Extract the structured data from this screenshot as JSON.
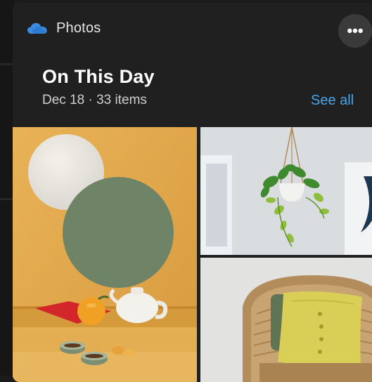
{
  "widget": {
    "app_name": "Photos",
    "app_icon": "onedrive-cloud-icon",
    "more_label": "•••",
    "title": "On This Day",
    "subtitle": "Dec 18 · 33 items",
    "see_all_label": "See all"
  },
  "colors": {
    "card_background": "#202020",
    "accent_link": "#4aa3e8",
    "cloud_icon": "#3c8de0"
  },
  "photos": [
    {
      "subject": "tea-set-still-life"
    },
    {
      "subject": "hanging-plant"
    },
    {
      "subject": "rattan-chair-with-pillow"
    }
  ]
}
